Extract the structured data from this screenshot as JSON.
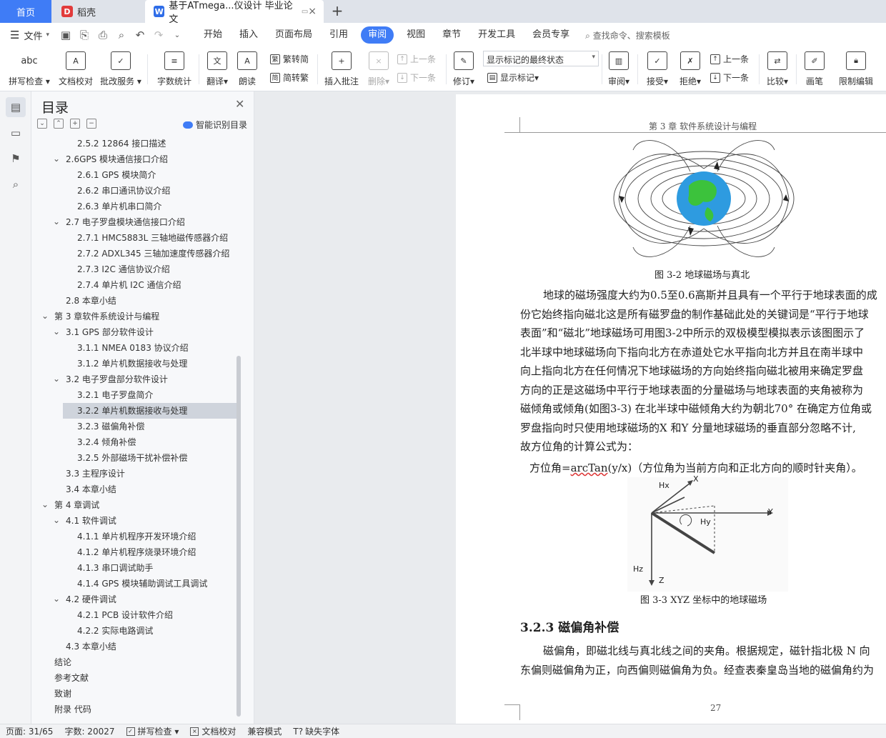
{
  "tabs": {
    "home": "首页",
    "daoke": "稻壳",
    "doc": "基于ATmega...仪设计 毕业论文",
    "close_icon": "×",
    "add_icon": "+"
  },
  "menubar": {
    "file": "文件",
    "items": [
      "开始",
      "插入",
      "页面布局",
      "引用",
      "审阅",
      "视图",
      "章节",
      "开发工具",
      "会员专享"
    ],
    "active_index": 4,
    "search_placeholder": "查找命令、搜索模板"
  },
  "ribbon": {
    "spellcheck": "拼写检查",
    "doc_proof": "文档校对",
    "annotate_service": "批改服务",
    "word_count": "字数统计",
    "translate": "翻译",
    "read_aloud": "朗读",
    "trad_to_simp": "繁转简",
    "simp_to_trad": "简转繁",
    "insert_comment": "插入批注",
    "delete": "删除",
    "prev_comment": "上一条",
    "next_comment": "下一条",
    "revise": "修订",
    "markup_state": "显示标记的最终状态",
    "show_markup": "显示标记",
    "review": "审阅",
    "accept": "接受",
    "reject": "拒绝",
    "prev_change": "上一条",
    "next_change": "下一条",
    "compare": "比较",
    "pen": "画笔",
    "restrict_edit": "限制编辑",
    "abc_icon_text": "abc"
  },
  "toc": {
    "title": "目录",
    "smart_toc": "智能识别目录",
    "items": [
      {
        "text": "2.5.2 12864 接口描述",
        "level": 3
      },
      {
        "text": "2.6GPS 模块通信接口介绍",
        "level": 2,
        "expanded": true
      },
      {
        "text": "2.6.1 GPS 模块简介",
        "level": 3
      },
      {
        "text": "2.6.2 串口通讯协议介绍",
        "level": 3
      },
      {
        "text": "2.6.3 单片机串口简介",
        "level": 3
      },
      {
        "text": "2.7 电子罗盘模块通信接口介绍",
        "level": 2,
        "expanded": true
      },
      {
        "text": "2.7.1 HMC5883L 三轴地磁传感器介绍",
        "level": 3
      },
      {
        "text": "2.7.2 ADXL345 三轴加速度传感器介绍",
        "level": 3
      },
      {
        "text": "2.7.3 I2C 通信协议介绍",
        "level": 3
      },
      {
        "text": "2.7.4 单片机 I2C 通信介绍",
        "level": 3
      },
      {
        "text": "2.8 本章小结",
        "level": 2
      },
      {
        "text": "第 3 章软件系统设计与编程",
        "level": 1,
        "expanded": true
      },
      {
        "text": "3.1 GPS 部分软件设计",
        "level": 2,
        "expanded": true
      },
      {
        "text": "3.1.1 NMEA 0183 协议介绍",
        "level": 3
      },
      {
        "text": "3.1.2 单片机数据接收与处理",
        "level": 3
      },
      {
        "text": "3.2  电子罗盘部分软件设计",
        "level": 2,
        "expanded": true
      },
      {
        "text": "3.2.1  电子罗盘简介",
        "level": 3
      },
      {
        "text": "3.2.2 单片机数据接收与处理",
        "level": 3,
        "selected": true
      },
      {
        "text": "3.2.3 磁偏角补偿",
        "level": 3
      },
      {
        "text": "3.2.4 倾角补偿",
        "level": 3
      },
      {
        "text": "3.2.5 外部磁场干扰补偿补偿",
        "level": 3
      },
      {
        "text": "3.3  主程序设计",
        "level": 2
      },
      {
        "text": "3.4 本章小结",
        "level": 2
      },
      {
        "text": "第 4 章调试",
        "level": 1,
        "expanded": true
      },
      {
        "text": "4.1 软件调试",
        "level": 2,
        "expanded": true
      },
      {
        "text": "4.1.1  单片机程序开发环境介绍",
        "level": 3
      },
      {
        "text": "4.1.2 单片机程序烧录环境介绍",
        "level": 3
      },
      {
        "text": "4.1.3 串口调试助手",
        "level": 3
      },
      {
        "text": "4.1.4 GPS 模块辅助调试工具调试",
        "level": 3
      },
      {
        "text": "4.2  硬件调试",
        "level": 2,
        "expanded": true
      },
      {
        "text": "4.2.1 PCB 设计软件介绍",
        "level": 3
      },
      {
        "text": "4.2.2 实际电路调试",
        "level": 3
      },
      {
        "text": "4.3 本章小结",
        "level": 2
      },
      {
        "text": "结论",
        "level": 1
      },
      {
        "text": "参考文献",
        "level": 1
      },
      {
        "text": "致谢",
        "level": 1
      },
      {
        "text": "附录  代码",
        "level": 1
      }
    ]
  },
  "document": {
    "header": "第 3 章  软件系统设计与编程",
    "fig1_caption": "图 3-2 地球磁场与真北",
    "para1": [
      "地球的磁场强度大约为0.5至0.6高斯并且具有一个平行于地球表面的成",
      "份它始终指向磁北这是所有磁罗盘的制作基础此处的关键词是“平行于地球",
      "表面”和“磁北”地球磁场可用图3-2中所示的双极模型模拟表示该图图示了",
      "北半球中地球磁场向下指向北方在赤道处它水平指向北方并且在南半球中",
      "向上指向北方在任何情况下地球磁场的方向始终指向磁北被用来确定罗盘",
      "方向的正是这磁场中平行于地球表面的分量磁场与地球表面的夹角被称为",
      "磁倾角或倾角(如图3-3)  在北半球中磁倾角大约为朝北70°  在确定方位角或",
      "罗盘指向时只使用地球磁场的X 和Y 分量地球磁场的垂直部分忽略不计,",
      "故方位角的计算公式为："
    ],
    "formula_prefix": "方位角=",
    "formula_fn": "arcTan",
    "formula_rest": "(y/x)（方位角为当前方向和正北方向的顺时针夹角）。",
    "fig2_labels": {
      "hx": "Hx",
      "x": "X",
      "y": "Y",
      "hy": "Hy",
      "hz": "Hz",
      "z": "Z"
    },
    "fig2_caption": "图 3-3 XYZ 坐标中的地球磁场",
    "section_heading": "3.2.3 磁偏角补偿",
    "para2": [
      "磁偏角，即磁北线与真北线之间的夹角。根据规定，磁针指北极 N 向",
      "东偏则磁偏角为正，向西偏则磁偏角为负。经查表秦皇岛当地的磁偏角约为"
    ],
    "page_number": "27"
  },
  "statusbar": {
    "page": "页面: 31/65",
    "words": "字数: 20027",
    "spellcheck": "拼写检查",
    "doc_proof": "文档校对",
    "compat": "兼容模式",
    "missing_font": "缺失字体"
  },
  "colors": {
    "accent": "#3f7cf6",
    "tab_bar": "#dfe3ea",
    "toc_selected": "#cfd4dc"
  }
}
